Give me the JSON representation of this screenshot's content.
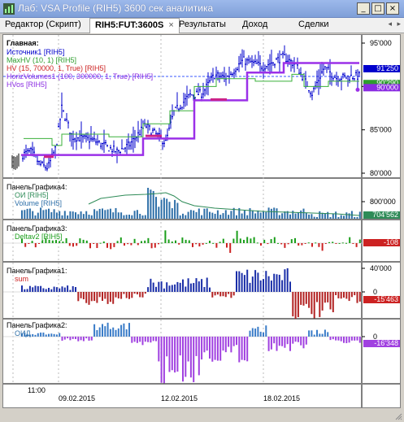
{
  "window": {
    "title": "Лаб: VSA Profile (RIH5) 3600 сек аналитика",
    "buttons": {
      "minimize": "_",
      "maximize": "□",
      "close": "×"
    }
  },
  "tabs": [
    {
      "label": "Редактор (Скрипт)",
      "active": false
    },
    {
      "label": "RIH5:FUT:3600S",
      "active": true,
      "close": "×"
    },
    {
      "label": "Результаты",
      "active": false
    },
    {
      "label": "Доход",
      "active": false
    },
    {
      "label": "Сделки",
      "active": false
    }
  ],
  "panels": {
    "main": {
      "title": "Главная:",
      "legend": [
        {
          "text": "Источник1 [RIH5]",
          "color": "#0000cc"
        },
        {
          "text": "MaxHV (10, 1) [RIH5]",
          "color": "#2e9e2e"
        },
        {
          "text": "HV (15, 70000, 1, True) [RIH5]",
          "color": "#cc2222"
        },
        {
          "text": "HorizVolumes1 (100, 300000, 1, True) [RIH5]",
          "color": "#8a2be2"
        },
        {
          "text": "HVos [RIH5]",
          "color": "#8a2be2"
        }
      ],
      "axis_ticks": [
        "95'000",
        "90'000",
        "85'000",
        "80'000"
      ],
      "price_tags": [
        {
          "text": "91'250",
          "color": "#0000cc"
        },
        {
          "text": "90'290",
          "color": "#2e9e2e"
        },
        {
          "text": "90'000",
          "color": "#8a2be2"
        }
      ]
    },
    "p4": {
      "title": "ПанельГрафика4:",
      "legend": [
        {
          "text": "ОИ [RIH5]",
          "color": "#2e8b57"
        },
        {
          "text": "Volume [RIH5]",
          "color": "#2e6fa8"
        }
      ],
      "axis_ticks": [
        "800'000"
      ],
      "value_tag": {
        "text": "704'562",
        "color": "#2e8b57"
      }
    },
    "p3": {
      "title": "ПанельГрафика3:",
      "legend": [
        {
          "text": "Deltav2 [RIH5]",
          "color": "#1a9e1a"
        }
      ],
      "value_tag": {
        "text": "-108",
        "color": "#cc2222"
      }
    },
    "p1": {
      "title": "ПанельГрафика1:",
      "legend": [
        {
          "text": "sum",
          "color": "#cc2222"
        }
      ],
      "axis_ticks": [
        "40'000",
        "0"
      ],
      "value_tag": {
        "text": "-15'463",
        "color": "#cc2222"
      }
    },
    "p2": {
      "title": "ПанельГрафика2:",
      "legend": [
        {
          "text": "ОИД",
          "color": "#2e6fa8"
        }
      ],
      "axis_ticks": [
        "0"
      ],
      "value_tag": {
        "text": "-16'348",
        "color": "#a040e0"
      }
    }
  },
  "time_axis": {
    "labels": [
      "11:00",
      "09.02.2015",
      "12.02.2015",
      "18.02.2015"
    ]
  }
}
